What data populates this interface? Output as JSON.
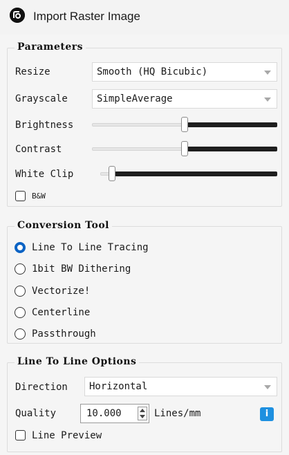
{
  "window": {
    "title": "Import Raster Image"
  },
  "parameters": {
    "legend": "Parameters",
    "resize": {
      "label": "Resize",
      "value": "Smooth (HQ Bicubic)"
    },
    "grayscale": {
      "label": "Grayscale",
      "value": "SimpleAverage"
    },
    "brightness": {
      "label": "Brightness",
      "level": 0.5
    },
    "contrast": {
      "label": "Contrast",
      "level": 0.5
    },
    "white_clip": {
      "label": "White Clip",
      "level": 0.05
    },
    "bw": {
      "label": "B&W",
      "checked": false
    }
  },
  "conversion": {
    "legend": "Conversion Tool",
    "options": [
      {
        "label": "Line To Line Tracing",
        "selected": true
      },
      {
        "label": "1bit BW Dithering",
        "selected": false
      },
      {
        "label": "Vectorize!",
        "selected": false
      },
      {
        "label": "Centerline",
        "selected": false
      },
      {
        "label": "Passthrough",
        "selected": false
      }
    ]
  },
  "line_options": {
    "legend": "Line To Line Options",
    "direction": {
      "label": "Direction",
      "value": "Horizontal"
    },
    "quality": {
      "label": "Quality",
      "value": "10.000",
      "unit": "Lines/mm"
    },
    "info_glyph": "i",
    "preview": {
      "label": "Line Preview",
      "checked": false
    }
  },
  "colors": {
    "accent": "#0b63c4",
    "info": "#1e90e0",
    "slider_dark": "#1e1e1e"
  }
}
